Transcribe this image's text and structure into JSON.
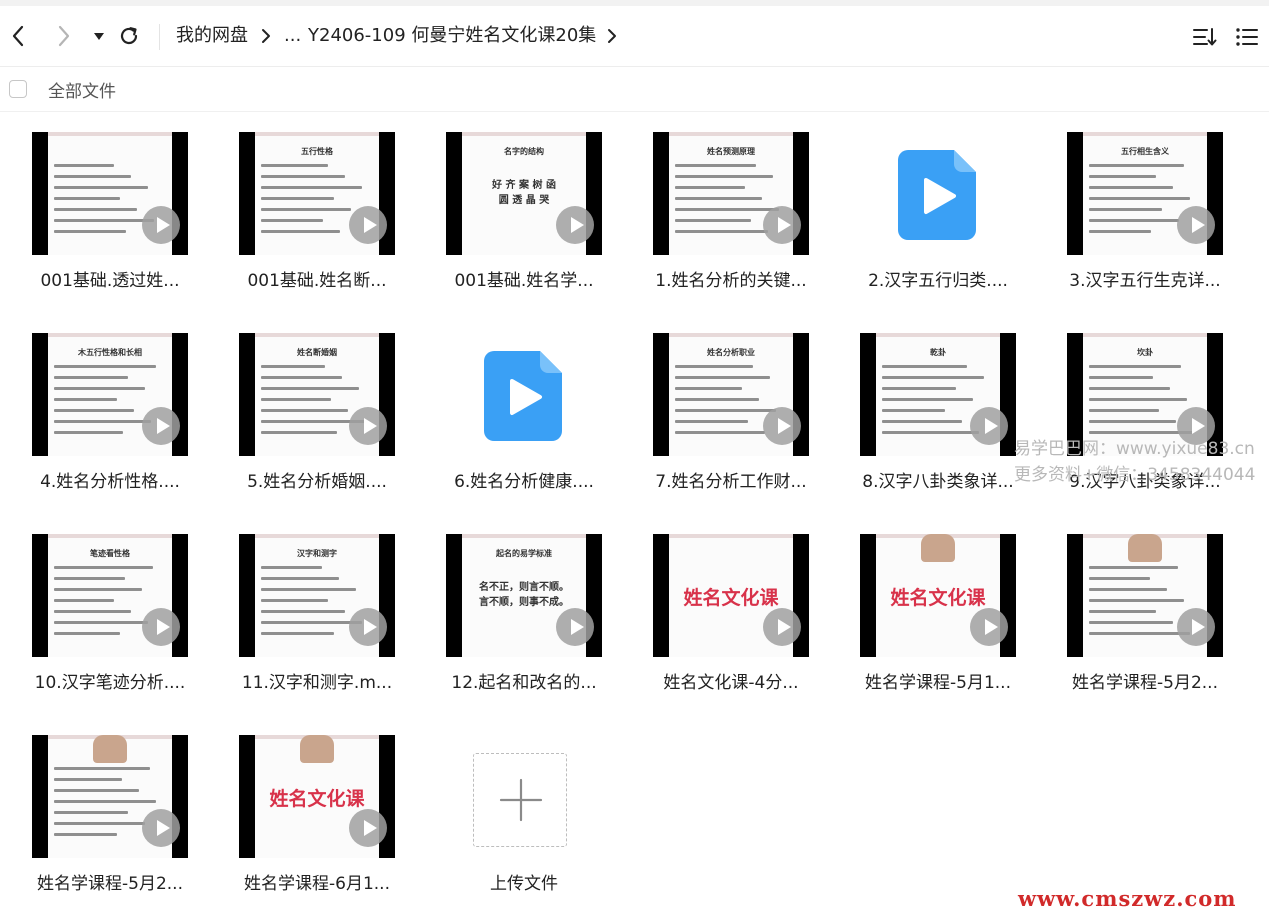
{
  "toolbar": {
    "breadcrumb": [
      "我的网盘",
      "...",
      "Y2406-109 何曼宁姓名文化课20集"
    ]
  },
  "selectbar": {
    "all_label": "全部文件"
  },
  "files": [
    {
      "name": "001基础.透过姓...",
      "kind": "video-thumb",
      "title": ""
    },
    {
      "name": "001基础.姓名断...",
      "kind": "video-thumb",
      "title": "五行性格"
    },
    {
      "name": "001基础.姓名学...",
      "kind": "video-thumb",
      "title": "名字的结构",
      "big": "好 齐 案 树 函\n圆 透 晶 哭"
    },
    {
      "name": "1.姓名分析的关键...",
      "kind": "video-thumb",
      "title": "姓名预测原理"
    },
    {
      "name": "2.汉字五行归类....",
      "kind": "video-icon"
    },
    {
      "name": "3.汉字五行生克详...",
      "kind": "video-thumb",
      "title": "五行相生含义"
    },
    {
      "name": "4.姓名分析性格....",
      "kind": "video-thumb",
      "title": "木五行性格和长相"
    },
    {
      "name": "5.姓名分析婚姻....",
      "kind": "video-thumb",
      "title": "姓名断婚姻"
    },
    {
      "name": "6.姓名分析健康....",
      "kind": "video-icon"
    },
    {
      "name": "7.姓名分析工作财...",
      "kind": "video-thumb",
      "title": "姓名分析职业"
    },
    {
      "name": "8.汉字八卦类象详...",
      "kind": "video-thumb",
      "title": "乾卦"
    },
    {
      "name": "9.汉字八卦类象详...",
      "kind": "video-thumb",
      "title": "坎卦"
    },
    {
      "name": "10.汉字笔迹分析....",
      "kind": "video-thumb",
      "title": "笔迹看性格"
    },
    {
      "name": "11.汉字和测字.m...",
      "kind": "video-thumb",
      "title": "汉字和测字"
    },
    {
      "name": "12.起名和改名的...",
      "kind": "video-thumb",
      "title": "起名的易学标准",
      "big": "名不正，则言不顺。\n言不顺，则事不成。"
    },
    {
      "name": "姓名文化课-4分...",
      "kind": "video-thumb",
      "title": "",
      "big": "姓名文化课"
    },
    {
      "name": "姓名学课程-5月1...",
      "kind": "video-thumb",
      "title": "",
      "big": "姓名文化课",
      "person": true
    },
    {
      "name": "姓名学课程-5月2...",
      "kind": "video-thumb",
      "title": "",
      "person": true
    },
    {
      "name": "姓名学课程-5月2...",
      "kind": "video-thumb",
      "title": "",
      "person": true
    },
    {
      "name": "姓名学课程-6月1...",
      "kind": "video-thumb",
      "title": "",
      "big": "姓名文化课",
      "person": true
    }
  ],
  "upload": {
    "label": "上传文件"
  },
  "watermarks": {
    "line1": "易学巴巴网：www.yixue83.cn",
    "line2": "更多资料+微信：3458344044",
    "line3": "www.cmszwz.com"
  },
  "colors": {
    "video_icon": "#3aa0f5",
    "play_overlay": "#a0a0a0",
    "watermark_red": "#d12a2a"
  }
}
